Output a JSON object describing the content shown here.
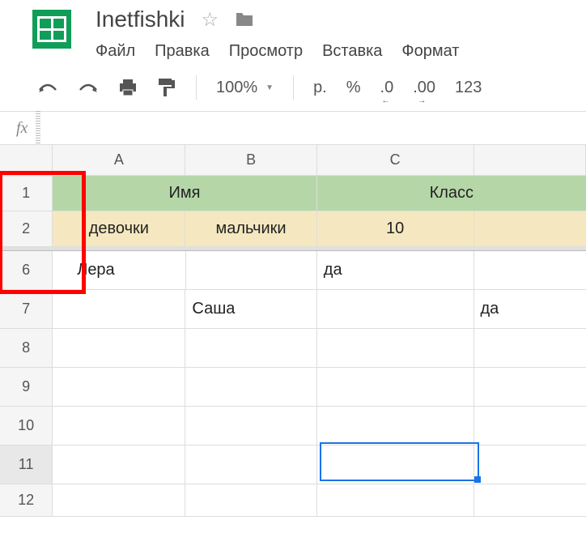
{
  "header": {
    "title": "Inetfishki"
  },
  "menubar": {
    "file": "Файл",
    "edit": "Правка",
    "view": "Просмотр",
    "insert": "Вставка",
    "format": "Формат"
  },
  "toolbar": {
    "zoom": "100%",
    "currency": "р.",
    "percent": "%",
    "dec_less": ".0",
    "dec_more": ".00",
    "more": "123"
  },
  "fxbar": {
    "label": "fx",
    "value": ""
  },
  "columns": [
    "A",
    "B",
    "C"
  ],
  "rows": {
    "visible": [
      "1",
      "2",
      "6",
      "7",
      "8",
      "9",
      "10",
      "11",
      "12"
    ]
  },
  "cells": {
    "r1_name": "Имя",
    "r1_class": "Класс",
    "r2_a": "девочки",
    "r2_b": "мальчики",
    "r2_c": "10",
    "r6_a": "Лера",
    "r6_c": "да",
    "r7_b": "Саша",
    "r7_d": "да"
  }
}
